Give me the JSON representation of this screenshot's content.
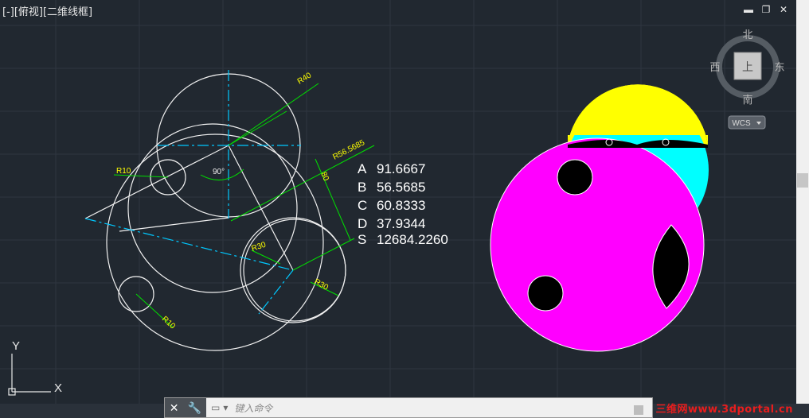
{
  "viewport": {
    "label": "[-][俯视][二维线框]"
  },
  "window_controls": {
    "minimize": "▬",
    "restore": "❐",
    "close": "✕"
  },
  "viewcube": {
    "north": "北",
    "south": "南",
    "east": "东",
    "west": "西",
    "face": "上",
    "wcs": "WCS"
  },
  "ucs": {
    "x_label": "X",
    "y_label": "Y"
  },
  "dimensions": {
    "r10_a": "R10",
    "r10_b": "R10",
    "r30_a": "R30",
    "r30_b": "R30",
    "r40": "R40",
    "r56": "R56.5685",
    "d80": "80",
    "angle": "90°"
  },
  "results": [
    {
      "key": "A",
      "value": "91.6667"
    },
    {
      "key": "B",
      "value": "56.5685"
    },
    {
      "key": "C",
      "value": "60.8333"
    },
    {
      "key": "D",
      "value": "37.9344"
    },
    {
      "key": "S",
      "value": "12684.2260"
    }
  ],
  "command_line": {
    "placeholder": "键入命令"
  },
  "watermark": "三维网www.3dportal.cn",
  "colors": {
    "background": "#212830",
    "yellow": "#ffff00",
    "cyan": "#00ffff",
    "magenta": "#ff00ff",
    "dim_green": "#00ff00",
    "center_line": "#00c8ff"
  }
}
